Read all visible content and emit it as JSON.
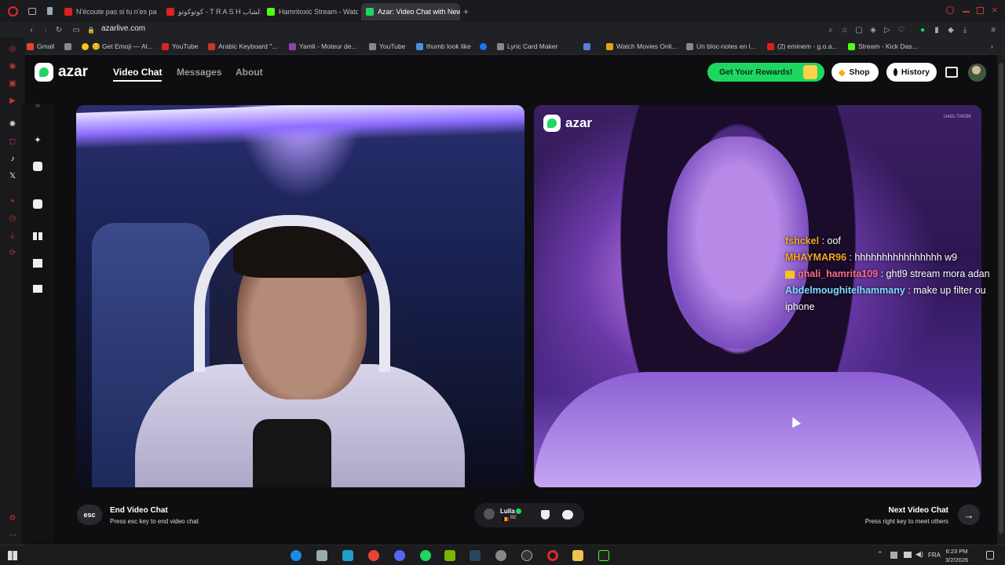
{
  "tabs": [
    {
      "title": "N'écoute pas si tu n'es pa",
      "color": "#e02020"
    },
    {
      "title": "كوتوكوتو - T R A S H الشاب",
      "color": "#e02020"
    },
    {
      "title": "Hamritoxic Stream - Watc",
      "color": "#53fc18"
    },
    {
      "title": "Azar: Video Chat with New",
      "color": "#1ed760"
    }
  ],
  "address": {
    "url": "azarlive.com"
  },
  "bookmarks": [
    {
      "label": "Gmail",
      "color": "#ea4335"
    },
    {
      "label": "",
      "color": "#888"
    },
    {
      "label": "😊 Get Emoji — Al...",
      "color": "#f5c518"
    },
    {
      "label": "YouTube",
      "color": "#e02020"
    },
    {
      "label": "Arabic Keyboard \"...",
      "color": "#c0392b"
    },
    {
      "label": "Yamli - Moteur de...",
      "color": "#8e44ad"
    },
    {
      "label": "YouTube",
      "color": "#888"
    },
    {
      "label": "thumb look like",
      "color": "#4a90e2"
    },
    {
      "label": "",
      "color": "#1877f2"
    },
    {
      "label": "Lyric Card Maker",
      "color": "#888"
    },
    {
      "label": "",
      "color": "#5b7fd6"
    },
    {
      "label": "Watch Movies Onli...",
      "color": "#e6a118"
    },
    {
      "label": "Un bloc-notes en l...",
      "color": "#888"
    },
    {
      "label": "(2) eminem - g.o.a...",
      "color": "#e02020"
    },
    {
      "label": "Stream - Kick Das...",
      "color": "#53fc18"
    }
  ],
  "header": {
    "logo_text": "azar",
    "nav": [
      "Video Chat",
      "Messages",
      "About"
    ],
    "rewards_label": "Get Your Rewards!",
    "shop_label": "Shop",
    "history_label": "History"
  },
  "remote": {
    "logo_text": "azar",
    "watermark": "Uedz-TAKBK"
  },
  "chat": [
    {
      "user": "fshckel",
      "text": " : oof",
      "color": "#f5a623",
      "crown": false
    },
    {
      "user": "MHAYMAR96",
      "text": " : hhhhhhhhhhhhhhhh w9",
      "color": "#f5a623",
      "crown": false
    },
    {
      "user": "ghali_hamrita109",
      "text": " : ghtl9 stream mora adan",
      "color": "#ff6b8a",
      "crown": true
    },
    {
      "user": "Abdelmoughitelhammany",
      "text": " : make up filter ou iphone",
      "color": "#7fdcff",
      "crown": false
    }
  ],
  "footer": {
    "esc_key": "esc",
    "end_title": "End Video Chat",
    "end_sub": "Press esc key to end video chat",
    "partner_name": "Lulla",
    "partner_country": "BE",
    "next_title": "Next Video Chat",
    "next_sub": "Press right key to meet others"
  },
  "taskbar": {
    "lang": "FRA",
    "time": "6:23 PM",
    "date": "3/2/2026"
  }
}
